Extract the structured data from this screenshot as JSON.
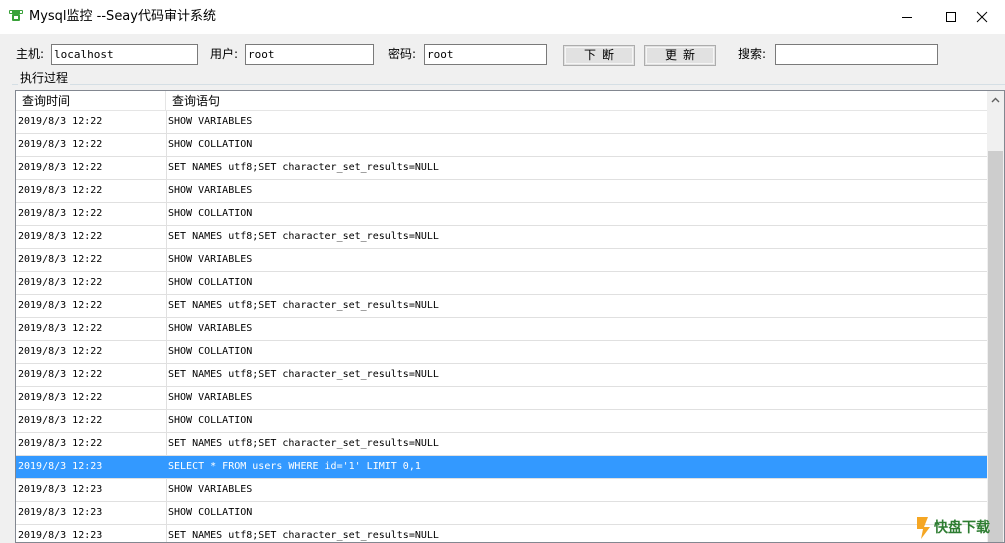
{
  "window": {
    "title": "Mysql监控 --Seay代码审计系统"
  },
  "toolbar": {
    "host_label": "主机:",
    "host_value": "localhost",
    "user_label": "用户:",
    "user_value": "root",
    "password_label": "密码:",
    "password_value": "root",
    "stop_button": "下断",
    "refresh_button": "更新",
    "search_label": "搜索:",
    "search_value": ""
  },
  "log_group": {
    "label": "执行过程",
    "columns": [
      "查询时间",
      "查询语句"
    ],
    "rows": [
      {
        "time": "2019/8/3 12:22",
        "query": "SHOW VARIABLES"
      },
      {
        "time": "2019/8/3 12:22",
        "query": "SHOW COLLATION"
      },
      {
        "time": "2019/8/3 12:22",
        "query": "SET NAMES utf8;SET character_set_results=NULL"
      },
      {
        "time": "2019/8/3 12:22",
        "query": "SHOW VARIABLES"
      },
      {
        "time": "2019/8/3 12:22",
        "query": "SHOW COLLATION"
      },
      {
        "time": "2019/8/3 12:22",
        "query": "SET NAMES utf8;SET character_set_results=NULL"
      },
      {
        "time": "2019/8/3 12:22",
        "query": "SHOW VARIABLES"
      },
      {
        "time": "2019/8/3 12:22",
        "query": "SHOW COLLATION"
      },
      {
        "time": "2019/8/3 12:22",
        "query": "SET NAMES utf8;SET character_set_results=NULL"
      },
      {
        "time": "2019/8/3 12:22",
        "query": "SHOW VARIABLES"
      },
      {
        "time": "2019/8/3 12:22",
        "query": "SHOW COLLATION"
      },
      {
        "time": "2019/8/3 12:22",
        "query": "SET NAMES utf8;SET character_set_results=NULL"
      },
      {
        "time": "2019/8/3 12:22",
        "query": "SHOW VARIABLES"
      },
      {
        "time": "2019/8/3 12:22",
        "query": "SHOW COLLATION"
      },
      {
        "time": "2019/8/3 12:22",
        "query": "SET NAMES utf8;SET character_set_results=NULL"
      },
      {
        "time": "2019/8/3 12:23",
        "query": "SELECT * FROM users WHERE id='1' LIMIT 0,1",
        "selected": true
      },
      {
        "time": "2019/8/3 12:23",
        "query": "SHOW VARIABLES"
      },
      {
        "time": "2019/8/3 12:23",
        "query": "SHOW COLLATION"
      },
      {
        "time": "2019/8/3 12:23",
        "query": "SET NAMES utf8;SET character_set_results=NULL"
      }
    ]
  },
  "colors": {
    "selection": "#3399ff",
    "window_bg": "#f0f0f0",
    "icon_green": "#3aa13a"
  },
  "icons": [
    "app-icon",
    "minimize-icon",
    "maximize-icon",
    "close-icon",
    "scroll-up-icon",
    "watermark-logo"
  ],
  "watermark": {
    "main": "快盘下载"
  }
}
